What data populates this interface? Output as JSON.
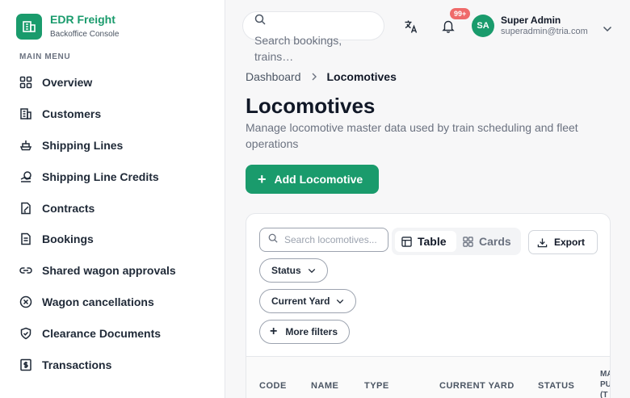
{
  "brand": {
    "name": "EDR Freight",
    "subtitle": "Backoffice Console"
  },
  "sidebar": {
    "section_label": "MAIN MENU",
    "items": [
      {
        "label": "Overview",
        "icon": "grid-icon"
      },
      {
        "label": "Customers",
        "icon": "building-icon"
      },
      {
        "label": "Shipping Lines",
        "icon": "ship-icon"
      },
      {
        "label": "Shipping Line Credits",
        "icon": "coins-icon"
      },
      {
        "label": "Contracts",
        "icon": "contract-icon"
      },
      {
        "label": "Bookings",
        "icon": "document-icon"
      },
      {
        "label": "Shared wagon approvals",
        "icon": "link-icon"
      },
      {
        "label": "Wagon cancellations",
        "icon": "x-circle-icon"
      },
      {
        "label": "Clearance Documents",
        "icon": "shield-icon"
      },
      {
        "label": "Transactions",
        "icon": "dollar-icon"
      }
    ]
  },
  "header": {
    "search_placeholder": "Search bookings, trains…",
    "notification_count": "99+",
    "user": {
      "initials": "SA",
      "name": "Super Admin",
      "email": "superadmin@tria.com"
    }
  },
  "breadcrumb": {
    "parent": "Dashboard",
    "current": "Locomotives"
  },
  "page": {
    "title": "Locomotives",
    "description": "Manage locomotive master data used by train scheduling and fleet operations",
    "add_button": "Add Locomotive"
  },
  "toolbar": {
    "search_placeholder": "Search locomotives...",
    "view_table": "Table",
    "view_cards": "Cards",
    "export": "Export",
    "filter_status": "Status",
    "filter_yard": "Current Yard",
    "more_filters": "More filters"
  },
  "table": {
    "columns": [
      "CODE",
      "NAME",
      "TYPE",
      "CURRENT YARD",
      "STATUS",
      "MA PU (T"
    ]
  },
  "colors": {
    "accent": "#1a9b6c",
    "badge": "#ef6a6a"
  }
}
